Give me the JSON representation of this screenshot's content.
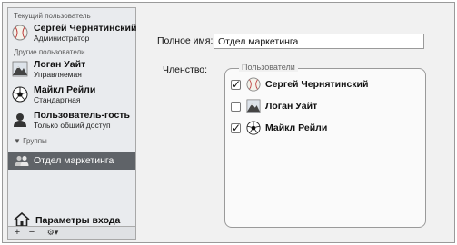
{
  "sidebar": {
    "current_section": "Текущий пользователь",
    "current_user": {
      "name": "Сергей Чернятинский",
      "role": "Администратор",
      "icon": "baseball-icon"
    },
    "others_section": "Другие пользователи",
    "other_users": [
      {
        "name": "Логан Уайт",
        "role": "Управляемая",
        "icon": "mountain-icon"
      },
      {
        "name": "Майкл Рейли",
        "role": "Стандартная",
        "icon": "soccer-ball-icon"
      },
      {
        "name": "Пользователь-гость",
        "role": "Только общий доступ",
        "icon": "guest-user-icon"
      }
    ],
    "groups_section": "Группы",
    "groups": [
      {
        "name": "Отдел маркетинга",
        "selected": true
      }
    ],
    "login_options": "Параметры входа",
    "bottom": {
      "add": "+",
      "remove": "−",
      "action": "⚙▾"
    }
  },
  "main": {
    "fullname_label": "Полное имя:",
    "fullname_value": "Отдел маркетинга",
    "membership_label": "Членство:",
    "members_legend": "Пользователи",
    "members": [
      {
        "name": "Сергей Чернятинский",
        "checked": true,
        "icon": "baseball-icon"
      },
      {
        "name": "Логан Уайт",
        "checked": false,
        "icon": "mountain-icon"
      },
      {
        "name": "Майкл Рейли",
        "checked": true,
        "icon": "soccer-ball-icon"
      }
    ]
  }
}
